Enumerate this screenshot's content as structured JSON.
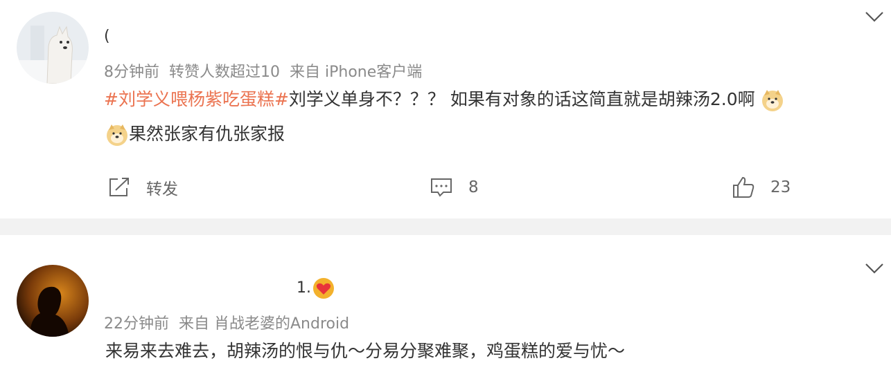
{
  "post1": {
    "name_fragment": "(",
    "time": "8分钟前",
    "repost_info": "转赞人数超过10",
    "source": "来自 iPhone客户端",
    "topic": "#刘学义喂杨紫吃蛋糕#",
    "text_line1": "刘学义单身不？？？ 如果有对象的话这简直就是胡辣汤2.0啊",
    "text_line2": "果然张家有仇张家报",
    "repost_label": "转发",
    "comment_count": "8",
    "like_count": "23"
  },
  "post2": {
    "name_fragment": "1.",
    "time": "22分钟前",
    "source": "来自 肖战老婆的Android",
    "text_line1": "来易来去难去，胡辣汤的恨与仇～分易分聚难聚，鸡蛋糕的爱与忧～"
  }
}
